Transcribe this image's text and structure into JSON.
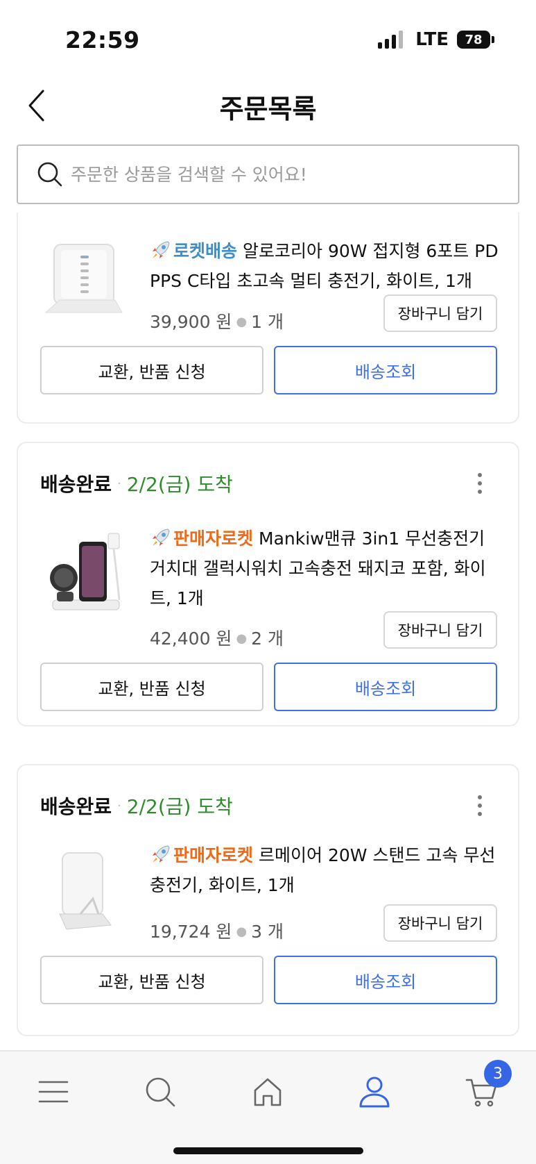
{
  "status_bar": {
    "time": "22:59",
    "network": "LTE",
    "battery": "78"
  },
  "header": {
    "title": "주문목록",
    "back_icon": "chevron-left-icon"
  },
  "search": {
    "placeholder": "주문한 상품을 검색할 수 있어요!",
    "value": "",
    "icon": "search-icon"
  },
  "orders": [
    {
      "status": "",
      "arrival": "",
      "badge": "로켓배송",
      "badge_type": "rocket",
      "product": "알로코리아 90W 접지형 6포트 PD PPS C타입 초고속 멀티 충전기, 화이트, 1개",
      "price": "39,900 원",
      "quantity": "1 개",
      "cart_label": "장바구니 담기",
      "exchange_label": "교환, 반품 신청",
      "track_label": "배송조회"
    },
    {
      "status": "배송완료",
      "arrival": "2/2(금) 도착",
      "badge": "판매자로켓",
      "badge_type": "seller",
      "product": "Mankiw맨큐 3in1 무선충전기 거치대 갤럭시워치 고속충전 돼지코 포함, 화이트, 1개",
      "price": "42,400 원",
      "quantity": "2 개",
      "cart_label": "장바구니 담기",
      "exchange_label": "교환, 반품 신청",
      "track_label": "배송조회"
    },
    {
      "status": "배송완료",
      "arrival": "2/2(금) 도착",
      "badge": "판매자로켓",
      "badge_type": "seller",
      "product": "르메이어 20W 스탠드 고속 무선충전기, 화이트, 1개",
      "price": "19,724 원",
      "quantity": "3 개",
      "cart_label": "장바구니 담기",
      "exchange_label": "교환, 반품 신청",
      "track_label": "배송조회"
    }
  ],
  "bottom_nav": {
    "items": [
      "menu-icon",
      "search-icon",
      "home-icon",
      "user-icon",
      "cart-icon"
    ],
    "active": "user-icon",
    "cart_count": "3"
  },
  "colors": {
    "accent": "#3e6ee8",
    "rocket": "#3f8ec9",
    "seller": "#ee6a1a",
    "delivered": "#2e8b2e"
  }
}
